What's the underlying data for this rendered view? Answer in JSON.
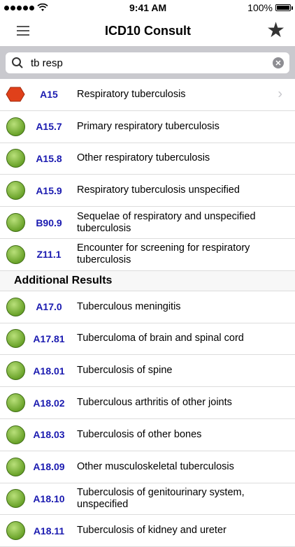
{
  "status": {
    "carrier_dots": 5,
    "time": "9:41 AM",
    "battery": "100%"
  },
  "nav": {
    "title": "ICD10 Consult",
    "menu_icon": "hamburger-icon",
    "favorite_icon": "star-icon"
  },
  "search": {
    "value": "tb resp",
    "icon": "search-icon",
    "clear_icon": "clear-icon"
  },
  "results": [
    {
      "code": "A15",
      "desc": "Respiratory tuberculosis",
      "icon": "hexagon",
      "disclosure": true
    },
    {
      "code": "A15.7",
      "desc": "Primary respiratory tuberculosis",
      "icon": "ball"
    },
    {
      "code": "A15.8",
      "desc": "Other respiratory tuberculosis",
      "icon": "ball"
    },
    {
      "code": "A15.9",
      "desc": "Respiratory tuberculosis unspecified",
      "icon": "ball"
    },
    {
      "code": "B90.9",
      "desc": "Sequelae of respiratory and unspecified tuberculosis",
      "icon": "ball"
    },
    {
      "code": "Z11.1",
      "desc": "Encounter for screening for respiratory tuberculosis",
      "icon": "ball"
    }
  ],
  "additional": {
    "title": "Additional Results",
    "items": [
      {
        "code": "A17.0",
        "desc": "Tuberculous meningitis"
      },
      {
        "code": "A17.81",
        "desc": "Tuberculoma of brain and spinal cord"
      },
      {
        "code": "A18.01",
        "desc": "Tuberculosis of spine"
      },
      {
        "code": "A18.02",
        "desc": "Tuberculous arthritis of other joints"
      },
      {
        "code": "A18.03",
        "desc": "Tuberculosis of other bones"
      },
      {
        "code": "A18.09",
        "desc": "Other musculoskeletal tuberculosis"
      },
      {
        "code": "A18.10",
        "desc": "Tuberculosis of genitourinary system, unspecified"
      },
      {
        "code": "A18.11",
        "desc": "Tuberculosis of kidney and ureter"
      }
    ]
  },
  "colors": {
    "code": "#1a1ab0",
    "hexagon": "#e0401a",
    "ball": "#7fb536"
  }
}
